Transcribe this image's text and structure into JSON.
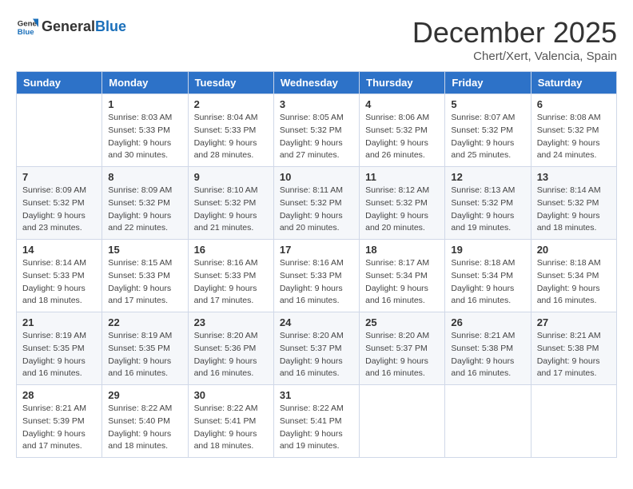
{
  "header": {
    "logo_general": "General",
    "logo_blue": "Blue",
    "month": "December 2025",
    "location": "Chert/Xert, Valencia, Spain"
  },
  "days_of_week": [
    "Sunday",
    "Monday",
    "Tuesday",
    "Wednesday",
    "Thursday",
    "Friday",
    "Saturday"
  ],
  "weeks": [
    [
      {
        "num": "",
        "info": ""
      },
      {
        "num": "1",
        "info": "Sunrise: 8:03 AM\nSunset: 5:33 PM\nDaylight: 9 hours\nand 30 minutes."
      },
      {
        "num": "2",
        "info": "Sunrise: 8:04 AM\nSunset: 5:33 PM\nDaylight: 9 hours\nand 28 minutes."
      },
      {
        "num": "3",
        "info": "Sunrise: 8:05 AM\nSunset: 5:32 PM\nDaylight: 9 hours\nand 27 minutes."
      },
      {
        "num": "4",
        "info": "Sunrise: 8:06 AM\nSunset: 5:32 PM\nDaylight: 9 hours\nand 26 minutes."
      },
      {
        "num": "5",
        "info": "Sunrise: 8:07 AM\nSunset: 5:32 PM\nDaylight: 9 hours\nand 25 minutes."
      },
      {
        "num": "6",
        "info": "Sunrise: 8:08 AM\nSunset: 5:32 PM\nDaylight: 9 hours\nand 24 minutes."
      }
    ],
    [
      {
        "num": "7",
        "info": "Sunrise: 8:09 AM\nSunset: 5:32 PM\nDaylight: 9 hours\nand 23 minutes."
      },
      {
        "num": "8",
        "info": "Sunrise: 8:09 AM\nSunset: 5:32 PM\nDaylight: 9 hours\nand 22 minutes."
      },
      {
        "num": "9",
        "info": "Sunrise: 8:10 AM\nSunset: 5:32 PM\nDaylight: 9 hours\nand 21 minutes."
      },
      {
        "num": "10",
        "info": "Sunrise: 8:11 AM\nSunset: 5:32 PM\nDaylight: 9 hours\nand 20 minutes."
      },
      {
        "num": "11",
        "info": "Sunrise: 8:12 AM\nSunset: 5:32 PM\nDaylight: 9 hours\nand 20 minutes."
      },
      {
        "num": "12",
        "info": "Sunrise: 8:13 AM\nSunset: 5:32 PM\nDaylight: 9 hours\nand 19 minutes."
      },
      {
        "num": "13",
        "info": "Sunrise: 8:14 AM\nSunset: 5:32 PM\nDaylight: 9 hours\nand 18 minutes."
      }
    ],
    [
      {
        "num": "14",
        "info": "Sunrise: 8:14 AM\nSunset: 5:33 PM\nDaylight: 9 hours\nand 18 minutes."
      },
      {
        "num": "15",
        "info": "Sunrise: 8:15 AM\nSunset: 5:33 PM\nDaylight: 9 hours\nand 17 minutes."
      },
      {
        "num": "16",
        "info": "Sunrise: 8:16 AM\nSunset: 5:33 PM\nDaylight: 9 hours\nand 17 minutes."
      },
      {
        "num": "17",
        "info": "Sunrise: 8:16 AM\nSunset: 5:33 PM\nDaylight: 9 hours\nand 16 minutes."
      },
      {
        "num": "18",
        "info": "Sunrise: 8:17 AM\nSunset: 5:34 PM\nDaylight: 9 hours\nand 16 minutes."
      },
      {
        "num": "19",
        "info": "Sunrise: 8:18 AM\nSunset: 5:34 PM\nDaylight: 9 hours\nand 16 minutes."
      },
      {
        "num": "20",
        "info": "Sunrise: 8:18 AM\nSunset: 5:34 PM\nDaylight: 9 hours\nand 16 minutes."
      }
    ],
    [
      {
        "num": "21",
        "info": "Sunrise: 8:19 AM\nSunset: 5:35 PM\nDaylight: 9 hours\nand 16 minutes."
      },
      {
        "num": "22",
        "info": "Sunrise: 8:19 AM\nSunset: 5:35 PM\nDaylight: 9 hours\nand 16 minutes."
      },
      {
        "num": "23",
        "info": "Sunrise: 8:20 AM\nSunset: 5:36 PM\nDaylight: 9 hours\nand 16 minutes."
      },
      {
        "num": "24",
        "info": "Sunrise: 8:20 AM\nSunset: 5:37 PM\nDaylight: 9 hours\nand 16 minutes."
      },
      {
        "num": "25",
        "info": "Sunrise: 8:20 AM\nSunset: 5:37 PM\nDaylight: 9 hours\nand 16 minutes."
      },
      {
        "num": "26",
        "info": "Sunrise: 8:21 AM\nSunset: 5:38 PM\nDaylight: 9 hours\nand 16 minutes."
      },
      {
        "num": "27",
        "info": "Sunrise: 8:21 AM\nSunset: 5:38 PM\nDaylight: 9 hours\nand 17 minutes."
      }
    ],
    [
      {
        "num": "28",
        "info": "Sunrise: 8:21 AM\nSunset: 5:39 PM\nDaylight: 9 hours\nand 17 minutes."
      },
      {
        "num": "29",
        "info": "Sunrise: 8:22 AM\nSunset: 5:40 PM\nDaylight: 9 hours\nand 18 minutes."
      },
      {
        "num": "30",
        "info": "Sunrise: 8:22 AM\nSunset: 5:41 PM\nDaylight: 9 hours\nand 18 minutes."
      },
      {
        "num": "31",
        "info": "Sunrise: 8:22 AM\nSunset: 5:41 PM\nDaylight: 9 hours\nand 19 minutes."
      },
      {
        "num": "",
        "info": ""
      },
      {
        "num": "",
        "info": ""
      },
      {
        "num": "",
        "info": ""
      }
    ]
  ]
}
